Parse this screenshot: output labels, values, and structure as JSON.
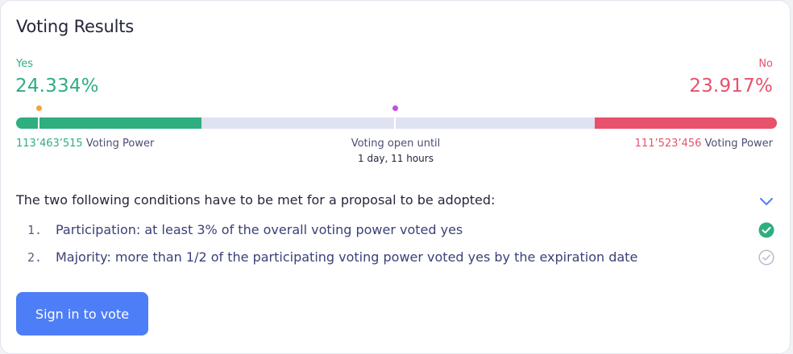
{
  "card": {
    "title": "Voting Results"
  },
  "results": {
    "yes_label": "Yes",
    "yes_percent": "24.334%",
    "no_label": "No",
    "no_percent": "23.917%",
    "yes_share": 0.24334,
    "no_share": 0.23917,
    "yes_voting_power": "113’463’515",
    "no_voting_power": "111’523’456",
    "voting_power_label": "Voting Power",
    "quorum_marker_share": 0.03,
    "majority_marker_share": 0.5,
    "colors": {
      "yes": "#2fae80",
      "no": "#e8516b",
      "track": "#dfe2f1",
      "quorum_marker": "#f4a43a",
      "majority_marker": "#c14fe6"
    }
  },
  "voting_window": {
    "label": "Voting open until",
    "remaining": "1 day, 11 hours"
  },
  "conditions": {
    "heading": "The two following conditions have to be met for a proposal to be adopted:",
    "toggle_icon": "chevron-down-icon",
    "items": [
      {
        "number": "1.",
        "text": "Participation: at least 3% of the overall voting power voted yes",
        "status": "met",
        "icon": "check-circle-filled-icon"
      },
      {
        "number": "2.",
        "text": "Majority: more than 1/2 of the participating voting power voted yes by the expiration date",
        "status": "pending",
        "icon": "check-circle-outline-icon"
      }
    ]
  },
  "actions": {
    "sign_in_label": "Sign in to vote",
    "accent": "#4d7ef7"
  }
}
